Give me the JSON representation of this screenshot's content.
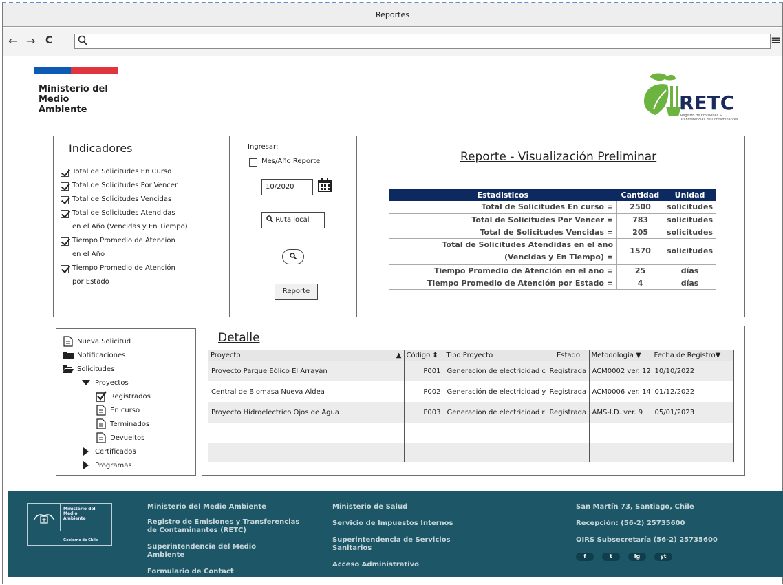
{
  "window": {
    "title": "Reportes"
  },
  "browser": {
    "back": "←",
    "forward": "→",
    "reload": "C",
    "search_glyph": "⚲",
    "menu_glyph": "≡"
  },
  "header": {
    "ministry_line1": "Ministerio del",
    "ministry_line2": "Medio",
    "ministry_line3": "Ambiente",
    "logo_text": "RETC",
    "logo_subtitle": "Registro de Emisiones & Transferencias de Contaminantes",
    "colors": {
      "gov_blue": "#0b5bb5",
      "gov_red": "#e0343f",
      "logo_green": "#6cb33f",
      "logo_navy": "#1b2a5c"
    }
  },
  "indicadores": {
    "title": "Indicadores",
    "items": [
      {
        "label": "Total de Solicitudes En Curso",
        "checked": true
      },
      {
        "label": "Total de Solicitudes Por Vencer",
        "checked": true
      },
      {
        "label": "Total de Solicitudes Vencidas",
        "checked": true
      },
      {
        "label": "Total de Solicitudes Atendidas",
        "label2": "en el Año (Vencidas y En Tiempo)",
        "checked": true
      },
      {
        "label": "Tiempo Promedio de Atención",
        "label2": "en el Año",
        "checked": true
      },
      {
        "label": "Tiempo Promedio de Atención",
        "label2": "por Estado",
        "checked": true
      }
    ]
  },
  "form": {
    "ingresar_label": "Ingresar:",
    "mes_ano_label": "Mes/Año Reporte",
    "date_value": "10/2020",
    "ruta_label": "Ruta local",
    "reporte_button": "Reporte"
  },
  "reporte": {
    "title": "Reporte - Visualización Preliminar",
    "headers": {
      "estadisticos": "Estadisticos",
      "cantidad": "Cantidad",
      "unidad": "Unidad"
    },
    "rows": [
      {
        "label": "Total de Solicitudes En curso =",
        "qty": "2500",
        "unit": "solicitudes"
      },
      {
        "label": "Total de Solicitudes Por Vencer =",
        "qty": "783",
        "unit": "solicitudes"
      },
      {
        "label": "Total de Solicitudes Vencidas =",
        "qty": "205",
        "unit": "solicitudes"
      },
      {
        "label": "Total de Solicitudes Atendidas en el año",
        "label2": "(Vencidas y En Tiempo)  =",
        "qty": "1570",
        "unit": "solicitudes"
      },
      {
        "label": "Tiempo Promedio de Atención en el año =",
        "qty": "25",
        "unit": "días"
      },
      {
        "label": "Tiempo Promedio de Atención por Estado =",
        "qty": "4",
        "unit": "días"
      }
    ]
  },
  "tree": {
    "nueva": "Nueva Solicitud",
    "notificaciones": "Notificaciones",
    "solicitudes": "Solicitudes",
    "proyectos": "Proyectos",
    "registrados": "Registrados",
    "en_curso": "En curso",
    "terminados": "Terminados",
    "devueltos": "Devueltos",
    "certificados": "Certificados",
    "programas": "Programas"
  },
  "detalle": {
    "title": "Detalle",
    "columns": {
      "proyecto": "Proyecto",
      "codigo": "Código",
      "tipo": "Tipo Proyecto",
      "estado": "Estado",
      "metodologia": "Metodología",
      "fecha": "Fecha de Registro"
    },
    "rows": [
      {
        "proyecto": "Proyecto Parque Eólico El Arrayán",
        "codigo": "P001",
        "tipo": "Generación de electricidad c",
        "estado": "Registrada",
        "metodologia": "ACM0002 ver. 12",
        "fecha": "10/10/2022"
      },
      {
        "proyecto": "Central de Biomasa Nueva Aldea",
        "codigo": "P002",
        "tipo": "Generación de electricidad y",
        "estado": "Registrada",
        "metodologia": "ACM0006 ver. 14",
        "fecha": "01/12/2022"
      },
      {
        "proyecto": "Proyecto Hidroeléctrico Ojos de Agua",
        "codigo": "P003",
        "tipo": "Generación de electricidad r",
        "estado": "Registrada",
        "metodologia": "AMS-I.D. ver. 9",
        "fecha": "05/01/2023"
      }
    ]
  },
  "footer": {
    "logo_line1": "Ministerio del",
    "logo_line2": "Medio",
    "logo_line3": "Ambiente",
    "logo_gov": "Gobierno de Chile",
    "col1": [
      "Ministerio del Medio Ambiente",
      "Registro de Emisiones y Transferencias de Contaminantes (RETC)",
      "Superintendencia del Medio Ambiente",
      "Formulario de Contact"
    ],
    "col2": [
      "Ministerio de Salud",
      "Servicio de Impuestos Internos",
      "Superintendencia de Servicios Sanitarios",
      "Acceso Administrativo"
    ],
    "col3": [
      "San Martín 73, Santiago, Chile",
      "Recepción: (56-2) 25735600",
      "OIRS Subsecretaría (56-2) 25735600"
    ],
    "social": [
      "f",
      "t",
      "ig",
      "yt"
    ],
    "background": "#1d5767"
  }
}
